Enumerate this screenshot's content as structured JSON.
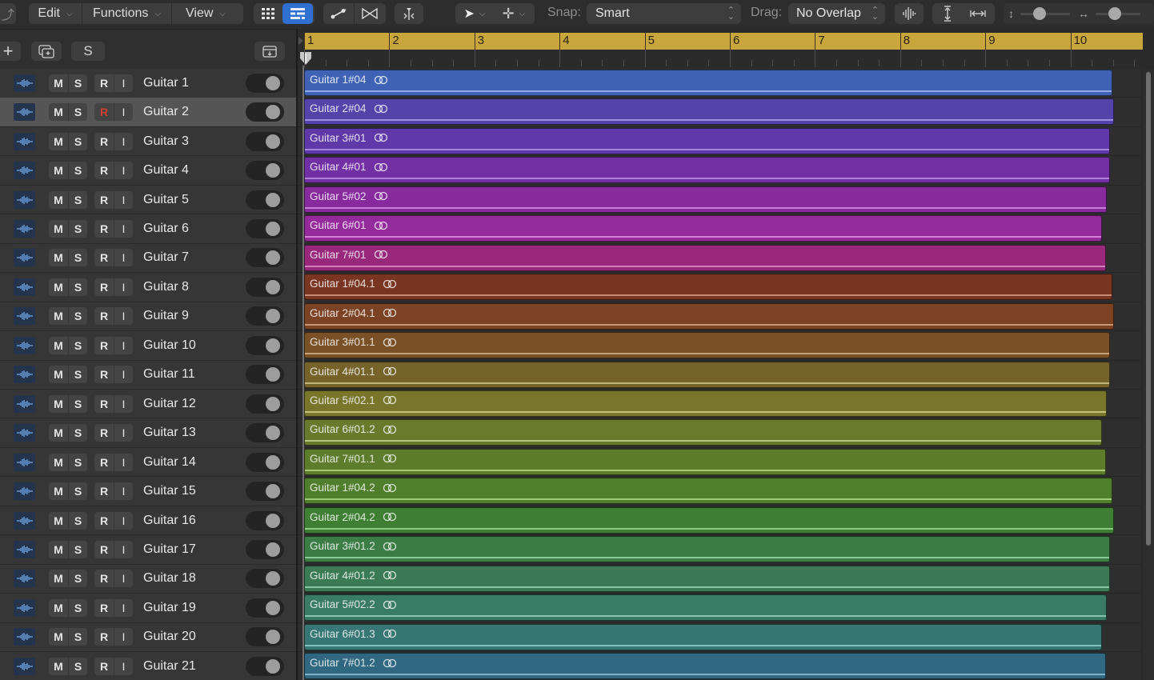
{
  "toolbar": {
    "back_icon": "back-arrow-icon",
    "menus": [
      {
        "label": "Edit"
      },
      {
        "label": "Functions"
      },
      {
        "label": "View"
      }
    ],
    "view_buttons": [
      {
        "icon": "grid-view-icon",
        "active": false
      },
      {
        "icon": "list-view-icon",
        "active": true
      }
    ],
    "automation_icons": [
      "automation-curve-icon",
      "crossfade-icon"
    ],
    "catch_icon": "catch-playhead-icon",
    "pointer_tool_icon": "pointer-tool-icon",
    "secondary_tool_icon": "crosshair-tool-icon",
    "snap_label": "Snap:",
    "snap_value": "Smart",
    "drag_label": "Drag:",
    "drag_value": "No Overlap",
    "waveform_zoom_icon": "waveform-zoom-icon",
    "vertical_fit_icon": "vertical-fit-icon",
    "horizontal_fit_icon": "horizontal-fit-icon",
    "vertical_zoom_icon": "vertical-zoom-icon",
    "vertical_zoom_level": 0.35,
    "horizontal_zoom_icon": "horizontal-zoom-icon",
    "horizontal_zoom_level": 0.4
  },
  "track_toolbar": {
    "add_track_label": "+",
    "duplicate_icon": "duplicate-track-icon",
    "solo_label": "S",
    "collapse_icon": "collapse-icon"
  },
  "ruler": {
    "bars": [
      "1",
      "2",
      "3",
      "4",
      "5",
      "6",
      "7",
      "8",
      "9",
      "10"
    ]
  },
  "track_buttons": {
    "mute": "M",
    "solo": "S",
    "record": "R",
    "input": "I"
  },
  "tracks": [
    {
      "name": "Guitar 1",
      "selected": false,
      "record_armed": false
    },
    {
      "name": "Guitar 2",
      "selected": true,
      "record_armed": true
    },
    {
      "name": "Guitar 3",
      "selected": false,
      "record_armed": false
    },
    {
      "name": "Guitar 4",
      "selected": false,
      "record_armed": false
    },
    {
      "name": "Guitar 5",
      "selected": false,
      "record_armed": false
    },
    {
      "name": "Guitar 6",
      "selected": false,
      "record_armed": false
    },
    {
      "name": "Guitar 7",
      "selected": false,
      "record_armed": false
    },
    {
      "name": "Guitar 8",
      "selected": false,
      "record_armed": false
    },
    {
      "name": "Guitar 9",
      "selected": false,
      "record_armed": false
    },
    {
      "name": "Guitar 10",
      "selected": false,
      "record_armed": false
    },
    {
      "name": "Guitar 11",
      "selected": false,
      "record_armed": false
    },
    {
      "name": "Guitar 12",
      "selected": false,
      "record_armed": false
    },
    {
      "name": "Guitar 13",
      "selected": false,
      "record_armed": false
    },
    {
      "name": "Guitar 14",
      "selected": false,
      "record_armed": false
    },
    {
      "name": "Guitar 15",
      "selected": false,
      "record_armed": false
    },
    {
      "name": "Guitar 16",
      "selected": false,
      "record_armed": false
    },
    {
      "name": "Guitar 17",
      "selected": false,
      "record_armed": false
    },
    {
      "name": "Guitar 18",
      "selected": false,
      "record_armed": false
    },
    {
      "name": "Guitar 19",
      "selected": false,
      "record_armed": false
    },
    {
      "name": "Guitar 20",
      "selected": false,
      "record_armed": false
    },
    {
      "name": "Guitar 21",
      "selected": false,
      "record_armed": false
    }
  ],
  "regions": [
    {
      "name": "Guitar 1#04",
      "color": "#3f62b5",
      "stripe": "#9fb6ee",
      "end_bar": 10.49
    },
    {
      "name": "Guitar 2#04",
      "color": "#5443a8",
      "stripe": "#a99be6",
      "end_bar": 10.51
    },
    {
      "name": "Guitar 3#01",
      "color": "#6138a8",
      "stripe": "#b293e8",
      "end_bar": 10.46
    },
    {
      "name": "Guitar 4#01",
      "color": "#7330a5",
      "stripe": "#c18ee6",
      "end_bar": 10.46
    },
    {
      "name": "Guitar 5#02",
      "color": "#862a9e",
      "stripe": "#d28fe2",
      "end_bar": 10.43
    },
    {
      "name": "Guitar 6#01",
      "color": "#952a9c",
      "stripe": "#dc8fe0",
      "end_bar": 10.37
    },
    {
      "name": "Guitar 7#01",
      "color": "#98287c",
      "stripe": "#dc8dc8",
      "end_bar": 10.42
    },
    {
      "name": "Guitar 1#04.1",
      "color": "#7a3522",
      "stripe": "#d39a83",
      "end_bar": 10.49
    },
    {
      "name": "Guitar 2#04.1",
      "color": "#7b4324",
      "stripe": "#d6a782",
      "end_bar": 10.51
    },
    {
      "name": "Guitar 3#01.1",
      "color": "#7a5126",
      "stripe": "#d6b086",
      "end_bar": 10.46
    },
    {
      "name": "Guitar 4#01.1",
      "color": "#76632a",
      "stripe": "#d1c389",
      "end_bar": 10.46
    },
    {
      "name": "Guitar 5#02.1",
      "color": "#77762b",
      "stripe": "#cfcf8a",
      "end_bar": 10.43
    },
    {
      "name": "Guitar 6#01.2",
      "color": "#6a7a2d",
      "stripe": "#c3d38b",
      "end_bar": 10.37
    },
    {
      "name": "Guitar 7#01.1",
      "color": "#5d7d2d",
      "stripe": "#b7d58b",
      "end_bar": 10.42
    },
    {
      "name": "Guitar 1#04.2",
      "color": "#4f7f2c",
      "stripe": "#aad789",
      "end_bar": 10.49
    },
    {
      "name": "Guitar 2#04.2",
      "color": "#3f7f33",
      "stripe": "#9bd896",
      "end_bar": 10.51
    },
    {
      "name": "Guitar 3#01.2",
      "color": "#3b7d45",
      "stripe": "#97d6a6",
      "end_bar": 10.46
    },
    {
      "name": "Guitar 4#01.2",
      "color": "#3a7b55",
      "stripe": "#96d4b3",
      "end_bar": 10.46
    },
    {
      "name": "Guitar 5#02.2",
      "color": "#3a7b66",
      "stripe": "#94d4c1",
      "end_bar": 10.43
    },
    {
      "name": "Guitar 6#01.3",
      "color": "#367674",
      "stripe": "#8fd1cd",
      "end_bar": 10.37
    },
    {
      "name": "Guitar 7#01.2",
      "color": "#2f6880",
      "stripe": "#8bbfd4",
      "end_bar": 10.42
    }
  ]
}
